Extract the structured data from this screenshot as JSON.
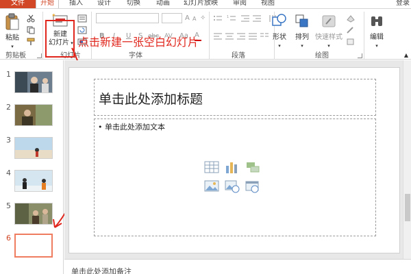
{
  "tabs": {
    "items": [
      "文件",
      "开始",
      "插入",
      "设计",
      "切换",
      "动画",
      "幻灯片放映",
      "审阅",
      "视图"
    ],
    "login": "登录"
  },
  "ribbon": {
    "paste_label": "粘贴",
    "new_slide_label_1": "新建",
    "new_slide_label_2": "幻灯片",
    "groups": {
      "clipboard": "剪贴板",
      "slides": "幻灯片",
      "font": "字体",
      "paragraph": "段落",
      "drawing": "绘图"
    },
    "shape_label": "形状",
    "arrange_label": "排列",
    "quick_styles_label": "快速样式",
    "edit_label": "编辑",
    "font_format": [
      "B",
      "I",
      "U",
      "S",
      "abc",
      "AV",
      "Aa"
    ]
  },
  "annotation": "点击新建一张空白幻灯片",
  "thumbnails": {
    "numbers": [
      "1",
      "2",
      "3",
      "4",
      "5",
      "6"
    ],
    "selected_index": 6
  },
  "slide": {
    "title_placeholder": "单击此处添加标题",
    "body_placeholder": "• 单击此处添加文本"
  },
  "notes": {
    "placeholder": "单击此处添加备注"
  },
  "colors": {
    "accent": "#d24726",
    "annotation": "#e0261c",
    "selected_thumb_border": "#ef7c5e"
  }
}
